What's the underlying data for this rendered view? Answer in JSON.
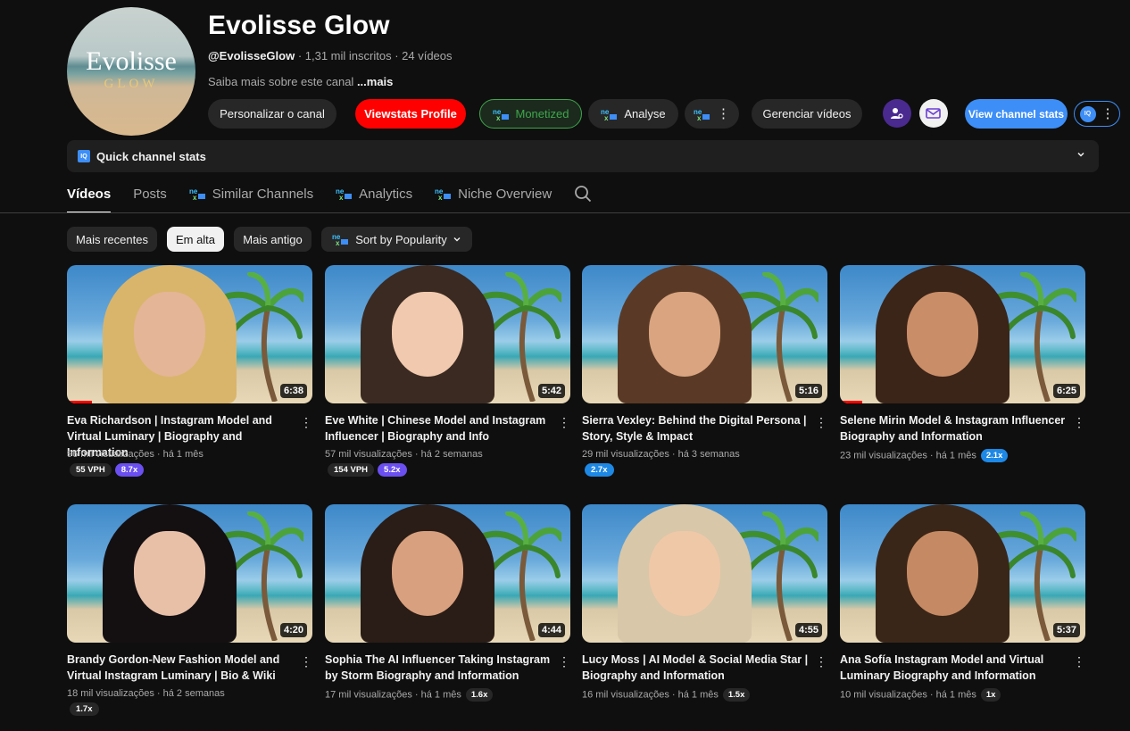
{
  "channel": {
    "avatar_title": "Evolisse",
    "avatar_sub": "GLOW",
    "name": "Evolisse Glow",
    "handle": "@EvolisseGlow",
    "subscribers": " · 1,31 mil inscritos · 24 vídeos",
    "description": "Saiba mais sobre este canal ",
    "more": "...mais"
  },
  "actions": {
    "customize": "Personalizar o canal",
    "viewstats": "Viewstats Profile",
    "monetized": "Monetized",
    "analyse": "Analyse",
    "manage": "Gerenciar vídeos",
    "view_stats": "View channel stats"
  },
  "quick_stats": {
    "label": "Quick channel stats",
    "badge": "IQ"
  },
  "tabs": [
    "Vídeos",
    "Posts",
    "Similar Channels",
    "Analytics",
    "Niche Overview"
  ],
  "chips": [
    "Mais recentes",
    "Em alta",
    "Mais antigo",
    "Sort by Popularity"
  ],
  "colors": {
    "accent_red": "#ff0000",
    "accent_blue": "#3d8ef7",
    "accent_green": "#3ea64b",
    "bg": "#0f0f0f"
  },
  "videos": [
    {
      "title": "Eva Richardson | Instagram Model and Virtual Luminary | Biography and Information",
      "views": "96 mil visualizações",
      "age": "há 1 mês",
      "duration": "6:38",
      "vph": "55 VPH",
      "mult": "8.7x",
      "progress": 0.1
    },
    {
      "title": "Eve White | Chinese Model and Instagram Influencer | Biography and Info",
      "views": "57 mil visualizações",
      "age": "há 2 semanas",
      "duration": "5:42",
      "vph": "154 VPH",
      "mult": "5.2x",
      "progress": 0
    },
    {
      "title": "Sierra Vexley: Behind the Digital Persona | Story, Style & Impact",
      "views": "29 mil visualizações",
      "age": "há 3 semanas",
      "duration": "5:16",
      "mult": "2.7x",
      "progress": 0
    },
    {
      "title": "Selene Mirin Model & Instagram Influencer Biography and Information",
      "views": "23 mil visualizações",
      "age": "há 1 mês",
      "duration": "6:25",
      "mult": "2.1x",
      "progress": 0.09
    },
    {
      "title": "Brandy Gordon-New Fashion Model and Virtual Instagram Luminary | Bio & Wiki",
      "views": "18 mil visualizações",
      "age": "há 2 semanas",
      "duration": "4:20",
      "mult": "1.7x",
      "progress": 0
    },
    {
      "title": "Sophia The AI Influencer Taking Instagram by Storm Biography and Information",
      "views": "17 mil visualizações",
      "age": "há 1 mês",
      "duration": "4:44",
      "mult": "1.6x",
      "progress": 0
    },
    {
      "title": "Lucy Moss | AI Model & Social Media Star | Biography and Information",
      "views": "16 mil visualizações",
      "age": "há 1 mês",
      "duration": "4:55",
      "mult": "1.5x",
      "progress": 0
    },
    {
      "title": "Ana Sofía Instagram Model and Virtual Luminary Biography and Information",
      "views": "10 mil visualizações",
      "age": "há 1 mês",
      "duration": "5:37",
      "mult": "1x",
      "progress": 0
    }
  ]
}
